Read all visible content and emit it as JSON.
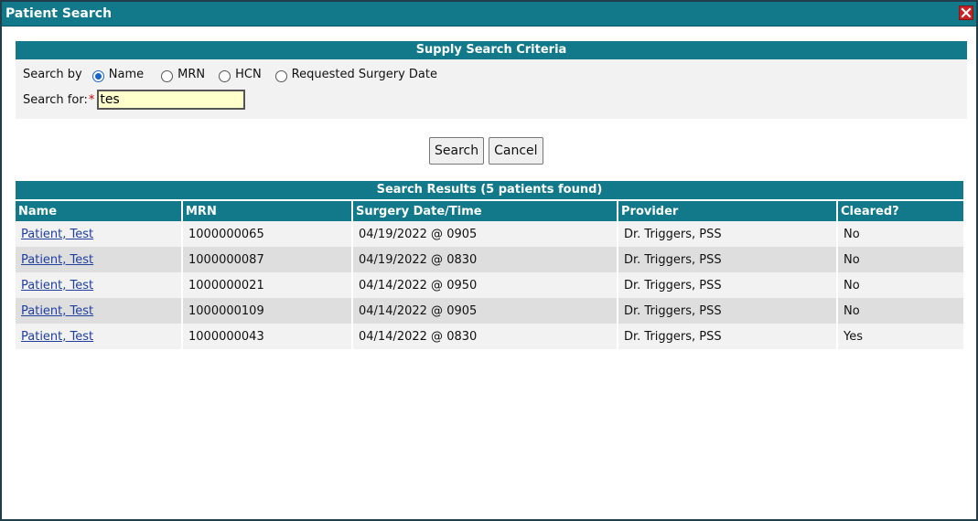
{
  "dialog": {
    "title": "Patient Search"
  },
  "criteria": {
    "header": "Supply Search Criteria",
    "search_by_label": "Search by",
    "options": [
      {
        "label": "Name",
        "checked": true
      },
      {
        "label": "MRN",
        "checked": false
      },
      {
        "label": "HCN",
        "checked": false
      },
      {
        "label": "Requested Surgery Date",
        "checked": false
      }
    ],
    "search_for_label": "Search for:",
    "required_marker": "*",
    "search_value": "tes"
  },
  "buttons": {
    "search": "Search",
    "cancel": "Cancel"
  },
  "results": {
    "header": "Search Results (5 patients found)",
    "columns": [
      "Name",
      "MRN",
      "Surgery Date/Time",
      "Provider",
      "Cleared?"
    ],
    "rows": [
      {
        "name": "Patient, Test",
        "mrn": "1000000065",
        "datetime": "04/19/2022 @ 0905",
        "provider": "Dr. Triggers, PSS",
        "cleared": "No"
      },
      {
        "name": "Patient, Test",
        "mrn": "1000000087",
        "datetime": "04/19/2022 @ 0830",
        "provider": "Dr. Triggers, PSS",
        "cleared": "No"
      },
      {
        "name": "Patient, Test",
        "mrn": "1000000021",
        "datetime": "04/14/2022 @ 0950",
        "provider": "Dr. Triggers, PSS",
        "cleared": "No"
      },
      {
        "name": "Patient, Test",
        "mrn": "1000000109",
        "datetime": "04/14/2022 @ 0905",
        "provider": "Dr. Triggers, PSS",
        "cleared": "No"
      },
      {
        "name": "Patient, Test",
        "mrn": "1000000043",
        "datetime": "04/14/2022 @ 0830",
        "provider": "Dr. Triggers, PSS",
        "cleared": "Yes"
      }
    ]
  },
  "icons": {
    "close": "close-icon"
  },
  "colors": {
    "header_teal": "#117989",
    "close_red": "#cc1f1f",
    "input_bg": "#ffffcc"
  }
}
